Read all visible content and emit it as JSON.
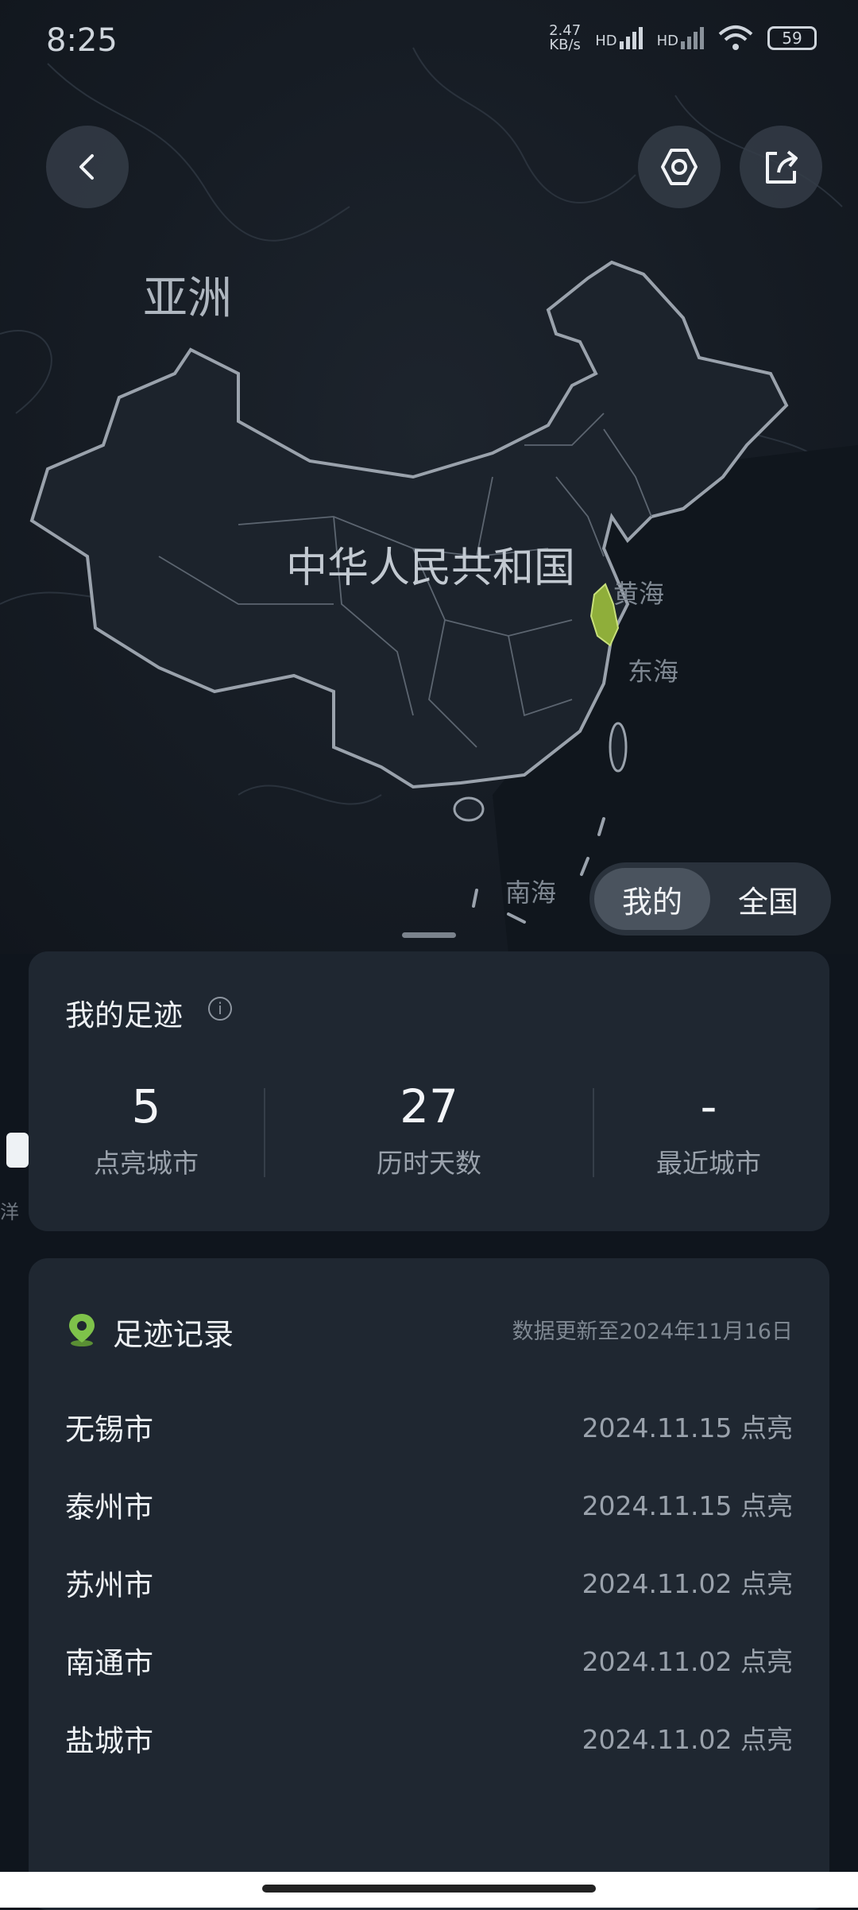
{
  "status_bar": {
    "time": "8:25",
    "net_speed_value": "2.47",
    "net_speed_unit": "KB/s",
    "signal1_label": "HD",
    "signal2_label": "HD",
    "battery": "59"
  },
  "map": {
    "labels": {
      "asia": "亚洲",
      "china": "中华人民共和国",
      "yellow_sea": "黄海",
      "east_sea": "东海",
      "south_sea": "南海"
    },
    "highlight_color": "#8fae3a"
  },
  "toggle": {
    "mine": "我的",
    "national": "全国",
    "selected": "我的"
  },
  "footprint": {
    "title": "我的足迹",
    "stats": [
      {
        "value": "5",
        "label": "点亮城市"
      },
      {
        "value": "27",
        "label": "历时天数"
      },
      {
        "value": "-",
        "label": "最近城市"
      }
    ]
  },
  "records": {
    "title": "足迹记录",
    "updated_note": "数据更新至2024年11月16日",
    "items": [
      {
        "city": "无锡市",
        "date": "2024.11.15 点亮"
      },
      {
        "city": "泰州市",
        "date": "2024.11.15 点亮"
      },
      {
        "city": "苏州市",
        "date": "2024.11.02 点亮"
      },
      {
        "city": "南通市",
        "date": "2024.11.02 点亮"
      },
      {
        "city": "盐城市",
        "date": "2024.11.02 点亮"
      }
    ]
  },
  "edge_text": "洋",
  "colors": {
    "background": "#0f151d",
    "card": "#1f2731",
    "accent_green": "#7ec24a"
  }
}
